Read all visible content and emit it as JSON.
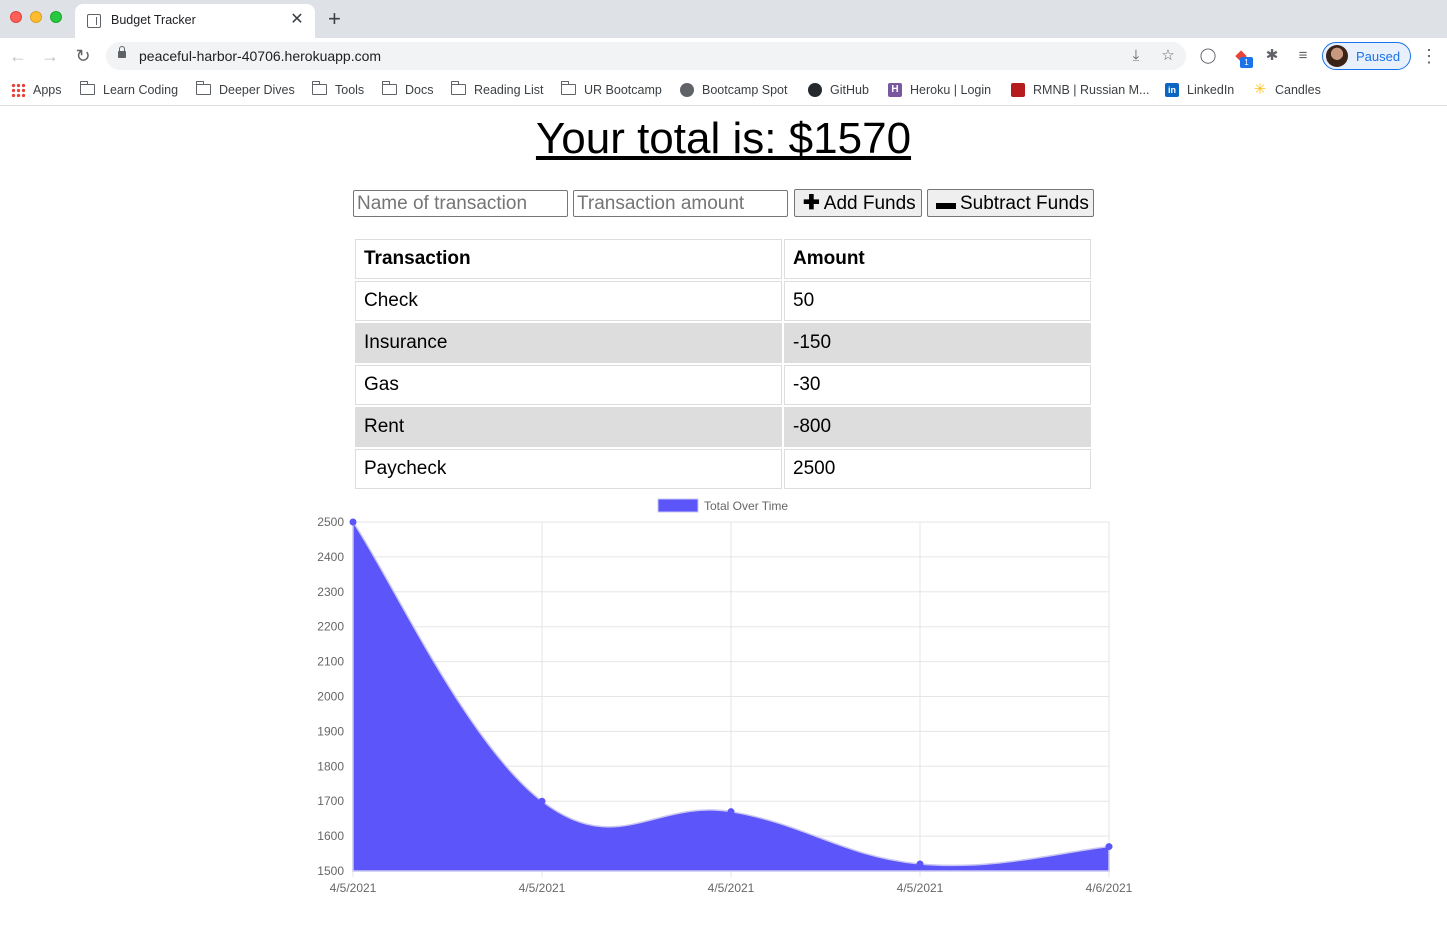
{
  "browser": {
    "tab_title": "Budget Tracker",
    "tab_close": "✕",
    "new_tab": "+",
    "url": "peaceful-harbor-40706.herokuapp.com",
    "profile_label": "Paused",
    "extension_badge": "1",
    "bookmarks": [
      {
        "label": "Apps",
        "icon": "apps-grid-icon"
      },
      {
        "label": "Learn Coding",
        "icon": "folder-icon"
      },
      {
        "label": "Deeper Dives",
        "icon": "folder-icon"
      },
      {
        "label": "Tools",
        "icon": "folder-icon"
      },
      {
        "label": "Docs",
        "icon": "folder-icon"
      },
      {
        "label": "Reading List",
        "icon": "folder-icon"
      },
      {
        "label": "UR Bootcamp",
        "icon": "folder-icon"
      },
      {
        "label": "Bootcamp Spot",
        "icon": "globe-icon"
      },
      {
        "label": "GitHub",
        "icon": "github-icon"
      },
      {
        "label": "Heroku | Login",
        "icon": "heroku-icon"
      },
      {
        "label": "RMNB | Russian M...",
        "icon": "rmnb-icon"
      },
      {
        "label": "LinkedIn",
        "icon": "linkedin-icon"
      },
      {
        "label": "Candles",
        "icon": "walmart-spark-icon"
      }
    ]
  },
  "page": {
    "total_text": "Your total is: $1570",
    "name_placeholder": "Name of transaction",
    "amount_placeholder": "Transaction amount",
    "add_label": "Add Funds",
    "subtract_label": "Subtract Funds",
    "table": {
      "headers": [
        "Transaction",
        "Amount"
      ],
      "rows": [
        {
          "name": "Check",
          "amount": "50"
        },
        {
          "name": "Insurance",
          "amount": "-150"
        },
        {
          "name": "Gas",
          "amount": "-30"
        },
        {
          "name": "Rent",
          "amount": "-800"
        },
        {
          "name": "Paycheck",
          "amount": "2500"
        }
      ]
    }
  },
  "chart_data": {
    "type": "area",
    "legend": "Total Over Time",
    "legend_position": "top",
    "fill_color": "#5c55fa",
    "x": [
      "4/5/2021",
      "4/5/2021",
      "4/5/2021",
      "4/5/2021",
      "4/6/2021"
    ],
    "series": [
      {
        "name": "Total Over Time",
        "values": [
          2500,
          1700,
          1670,
          1520,
          1570
        ]
      }
    ],
    "ylim": [
      1500,
      2500
    ],
    "yticks": [
      1500,
      1600,
      1700,
      1800,
      1900,
      2000,
      2100,
      2200,
      2300,
      2400,
      2500
    ],
    "grid": true
  }
}
